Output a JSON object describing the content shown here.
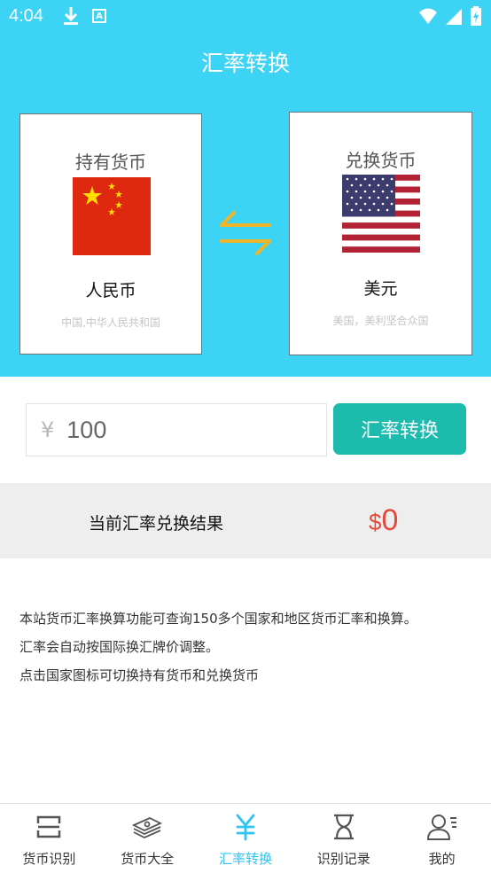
{
  "status_bar": {
    "time": "4:04",
    "a_icon_letter": "A"
  },
  "header": {
    "title": "汇率转换"
  },
  "holding": {
    "heading": "持有货币",
    "name": "人民币",
    "subtitle": "中国,中华人民共和国"
  },
  "target": {
    "heading": "兑换货币",
    "name": "美元",
    "subtitle": "美国，美利坚合众国"
  },
  "amount": {
    "symbol": "¥",
    "value": "100"
  },
  "convert_button": {
    "label": "汇率转换"
  },
  "result": {
    "label": "当前汇率兑换结果",
    "currency": "$",
    "value": "0"
  },
  "description": [
    "本站货币汇率换算功能可查询150多个国家和地区货币汇率和换算。",
    "汇率会自动按国际换汇牌价调整。",
    "点击国家图标可切换持有货币和兑换货币"
  ],
  "colors": {
    "header": "#3dd3f4",
    "button": "#1dbaae",
    "result": "#e4493a",
    "active_tab": "#2ec3f0",
    "swap": "#f0b429"
  },
  "bottom_nav": [
    {
      "label": "货币识别",
      "icon": "scan-icon"
    },
    {
      "label": "货币大全",
      "icon": "money-stack-icon"
    },
    {
      "label": "汇率转换",
      "icon": "yen-icon",
      "active": true
    },
    {
      "label": "识别记录",
      "icon": "hourglass-icon"
    },
    {
      "label": "我的",
      "icon": "user-icon"
    }
  ]
}
